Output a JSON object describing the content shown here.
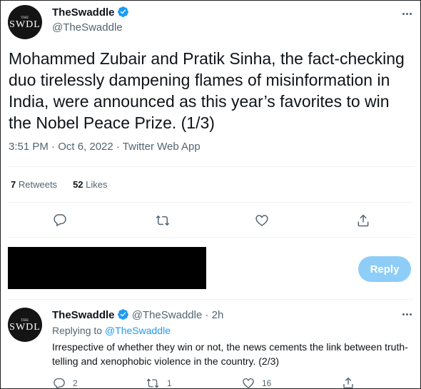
{
  "main_tweet": {
    "avatar": {
      "the": "THE",
      "mark": "SWDL"
    },
    "display_name": "TheSwaddle",
    "handle": "@TheSwaddle",
    "text": "Mohammed Zubair and Pratik Sinha, the fact-checking duo tirelessly dampening flames of misinformation in India, were announced as this year’s favorites to win the Nobel Peace Prize. (1/3)",
    "timestamp": "3:51 PM · Oct 6, 2022 · Twitter Web App",
    "retweets_count": "7",
    "retweets_label": "Retweets",
    "likes_count": "52",
    "likes_label": "Likes",
    "icons": [
      "reply-icon",
      "retweet-icon",
      "like-icon",
      "share-icon"
    ]
  },
  "composer": {
    "reply_button_label": "Reply"
  },
  "reply_tweet": {
    "avatar": {
      "the": "THE",
      "mark": "SWDL"
    },
    "display_name": "TheSwaddle",
    "handle": "@TheSwaddle",
    "separator": "·",
    "time": "2h",
    "replying_prefix": "Replying to",
    "replying_handle": "@TheSwaddle",
    "text": "Irrespective of whether they win or not, the news cements the link between truth-telling and xenophobic violence in the country. (2/3)",
    "reply_count": "2",
    "retweet_count": "1",
    "like_count": "16"
  },
  "colors": {
    "accent": "#1d9bf0",
    "reply_button_disabled": "#8ecdf8",
    "secondary_text": "#536471",
    "divider": "#eff3f4"
  }
}
